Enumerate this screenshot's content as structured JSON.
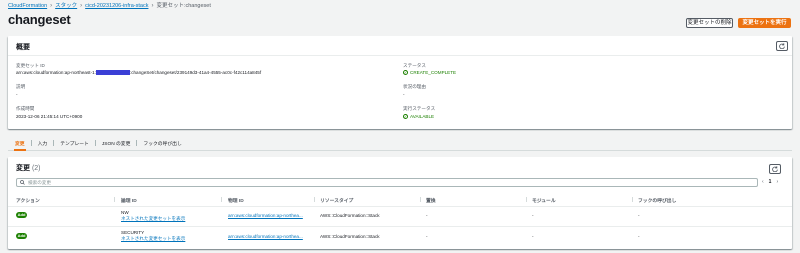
{
  "breadcrumb": {
    "items": [
      "CloudFormation",
      "スタック",
      "cicd-20231206-infra-stack"
    ],
    "current": "変更セット:changeset"
  },
  "page": {
    "title": "changeset",
    "delete_button": "変更セットの削除",
    "execute_button": "変更セットを実行"
  },
  "overview": {
    "heading": "概要",
    "changeset_id_label": "変更セット ID",
    "changeset_id_prefix": "arn:aws:cloudformation:ap-northeast-1:",
    "changeset_id_suffix": ":changeSet/changeset/239149d3-41a4-4555-ac0c-f42c114a845f",
    "status_label": "ステータス",
    "status_value": "CREATE_COMPLETE",
    "description_label": "説明",
    "description_value": "-",
    "status_reason_label": "状況の理由",
    "status_reason_value": "-",
    "created_label": "作成時間",
    "created_value": "2023-12-06 21:45:14 UTC+0900",
    "exec_status_label": "実行ステータス",
    "exec_status_value": "AVAILABLE"
  },
  "tabs": [
    "変更",
    "入力",
    "テンプレート",
    "JSON の変更",
    "フックの呼び出し"
  ],
  "changes": {
    "heading": "変更",
    "count": "(2)",
    "search_placeholder": "検索の変更",
    "page_number": "1",
    "columns": [
      "アクション",
      "論理 ID",
      "物理 ID",
      "リソースタイプ",
      "置換",
      "モジュール",
      "フックの呼び出し"
    ],
    "rows": [
      {
        "action": "Add",
        "logical_id": "NW",
        "nested_link": "ネストされた変更セットを表示",
        "physical_id": "arn:aws:cloudformation:ap-northea...",
        "resource_type": "AWS::CloudFormation::Stack",
        "replacement": "-",
        "module": "-",
        "hooks": "-"
      },
      {
        "action": "Add",
        "logical_id": "SECURITY",
        "nested_link": "ネストされた変更セットを表示",
        "physical_id": "arn:aws:cloudformation:ap-northea...",
        "resource_type": "AWS::CloudFormation::Stack",
        "replacement": "-",
        "module": "-",
        "hooks": "-"
      }
    ]
  }
}
